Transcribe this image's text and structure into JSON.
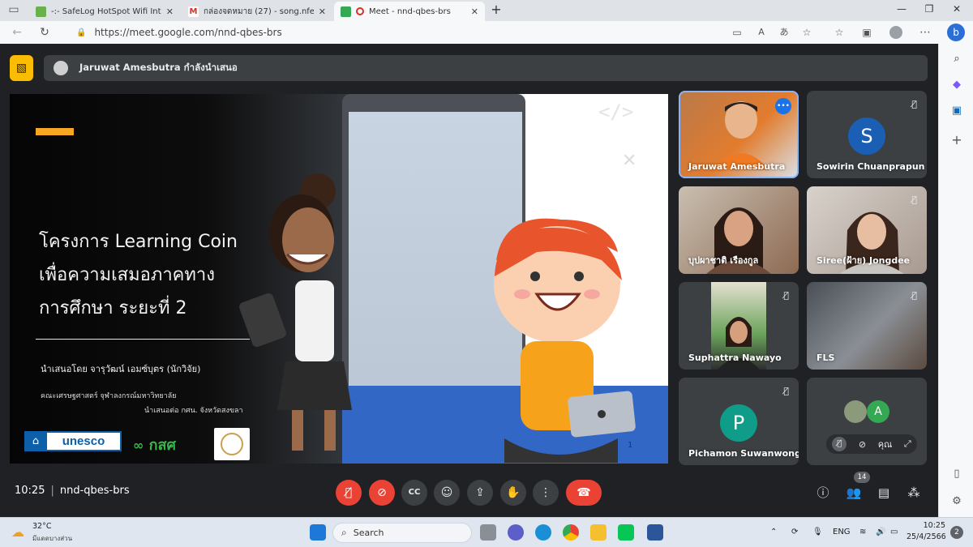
{
  "browser": {
    "tabs": [
      {
        "title": "-:- SafeLog HotSpot Wifi Interne",
        "active": false
      },
      {
        "title": "กล่องจดหมาย (27) - song.nfe.sk@g",
        "active": false
      },
      {
        "title": "Meet - nnd-qbes-brs",
        "active": true
      }
    ],
    "new_tab": "+",
    "url": "https://meet.google.com/nnd-qbes-brs",
    "window_controls": [
      "—",
      "❐",
      "✕"
    ]
  },
  "meet": {
    "presenting_banner": "Jaruwat Amesbutra กำลังนำเสนอ",
    "slide": {
      "title_lines": [
        "โครงการ Learning Coin",
        "เพื่อความเสมอภาคทาง",
        "การศึกษา ระยะที่ 2"
      ],
      "presenter": "นำเสนอโดย จารุวัฒน์ เอมซ์บุตร (นักวิจัย)",
      "org_line1": "คณะเศรษฐศาสตร์ จุฬาลงกรณ์มหาวิทยาลัย",
      "org_line2": "นำเสนอต่อ กศน. จังหวัดสงขลา",
      "logo_unesco": "unesco",
      "logo_ksst": "กสศ",
      "page": "1",
      "code_tag": "</>"
    },
    "participants": [
      {
        "name": "Jaruwat Amesbutra",
        "muted": false,
        "speaking": true,
        "video": true
      },
      {
        "name": "Sowirin Chuanprapun",
        "initial": "S",
        "muted": true,
        "avatar_color": "#1a5fb4"
      },
      {
        "name": "บุปผาชาติ เรืองกูล",
        "muted": false,
        "video": true
      },
      {
        "name": "Siree(ฝ้าย) Jongdee",
        "muted": true,
        "video": true
      },
      {
        "name": "Suphattra Nawayo",
        "muted": true,
        "video": true
      },
      {
        "name": "FLS",
        "muted": true,
        "video": true
      },
      {
        "name": "Pichamon Suwanwong",
        "initial": "P",
        "muted": true,
        "avatar_color": "#0f9d8a"
      },
      {
        "name": "คุณ",
        "initial": "A",
        "muted": true,
        "self": true,
        "avatar_color": "#34a853"
      }
    ],
    "meeting_time": "10:25",
    "meeting_code": "nnd-qbes-brs",
    "people_count": "14"
  },
  "taskbar": {
    "weather_temp": "32°C",
    "weather_desc": "มีแดดบางส่วน",
    "search_label": "Search",
    "lang": "ENG",
    "time": "10:25",
    "date": "25/4/2566"
  },
  "colors": {
    "meet_bg": "#202124",
    "tile_bg": "#3c4043",
    "danger": "#ea4335",
    "accent": "#f5a623",
    "speaking_outline": "#8ab4f8"
  }
}
